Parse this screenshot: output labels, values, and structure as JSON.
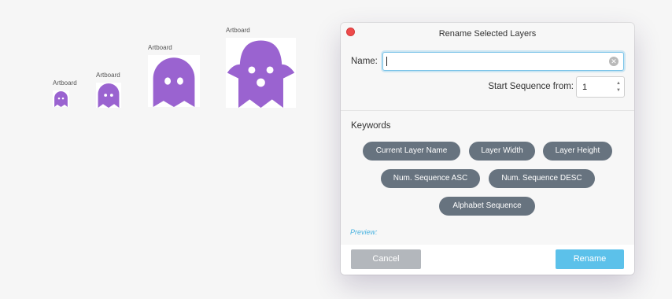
{
  "artboards": [
    {
      "label": "Artboard"
    },
    {
      "label": "Artboard"
    },
    {
      "label": "Artboard"
    },
    {
      "label": "Artboard"
    }
  ],
  "dialog": {
    "title": "Rename Selected Layers",
    "name_label": "Name:",
    "name_value": "",
    "start_sequence_label": "Start Sequence from:",
    "start_sequence_value": "1",
    "keywords_heading": "Keywords",
    "keywords": [
      "Current Layer Name",
      "Layer Width",
      "Layer Height",
      "Num. Sequence ASC",
      "Num. Sequence DESC",
      "Alphabet Sequence"
    ],
    "preview_label": "Preview:",
    "cancel_label": "Cancel",
    "rename_label": "Rename"
  },
  "colors": {
    "ghost": "#9a63d0",
    "chip": "#67737f",
    "accent": "#5cc1ea",
    "close": "#ee4b4b"
  }
}
